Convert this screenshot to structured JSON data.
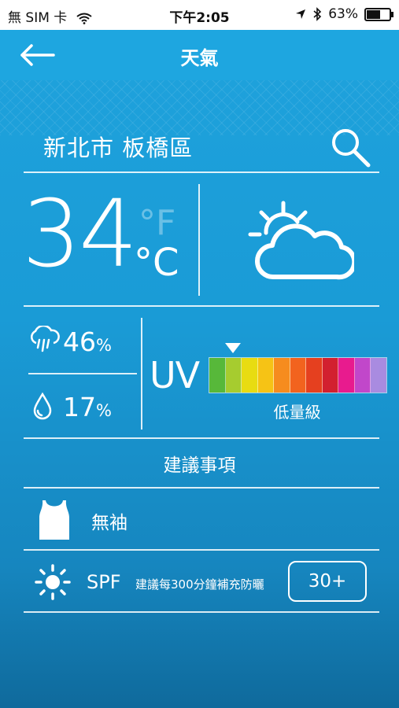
{
  "status_bar": {
    "carrier": "無 SIM 卡",
    "time": "下午2:05",
    "battery_percent": "63%",
    "battery_level": 0.63,
    "icons": [
      "wifi-icon",
      "location-arrow-icon",
      "bluetooth-icon",
      "battery-icon"
    ]
  },
  "nav": {
    "title": "天氣",
    "back_icon": "back-arrow-icon"
  },
  "location": {
    "name": "新北市 板橋區",
    "search_icon": "search-icon"
  },
  "current": {
    "temperature": "34",
    "unit_f": "°F",
    "unit_c": "°C",
    "condition_icon": "partly-cloudy-icon"
  },
  "rain": {
    "value": "46",
    "unit": "%",
    "icon": "cloud-rain-icon"
  },
  "humidity": {
    "value": "17",
    "unit": "%",
    "icon": "water-drop-icon"
  },
  "uv": {
    "label": "UV",
    "level_text": "低量級",
    "selected_index": 1,
    "scale_colors": [
      "#57b83a",
      "#a6cc2f",
      "#e8dc12",
      "#f6c315",
      "#f68c1e",
      "#f2631e",
      "#e5401f",
      "#d2202f",
      "#e81b8e",
      "#c147ca",
      "#a98be0"
    ]
  },
  "advice": {
    "title": "建議事項",
    "clothing_text": "無袖",
    "clothing_icon": "tank-top-icon",
    "spf_label": "SPF",
    "spf_note": "建議每300分鐘補充防曬",
    "spf_value": "30+",
    "sun_icon": "sun-icon"
  }
}
